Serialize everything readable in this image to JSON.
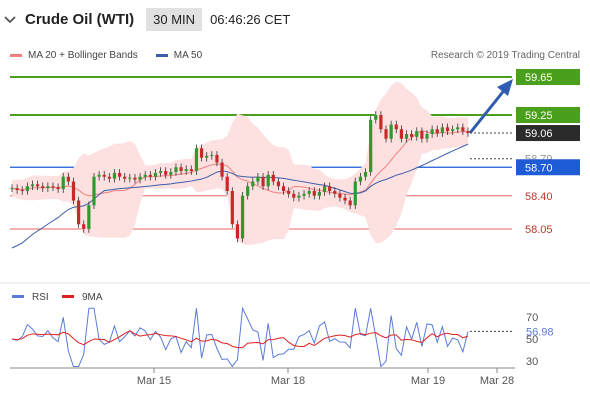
{
  "header": {
    "title": "Crude Oil (WTI)",
    "timeframe": "30 MIN",
    "time": "06:46:26 CET"
  },
  "legend": {
    "ma20_bb": "MA 20 + Bollinger Bands",
    "ma50": "MA 50",
    "copyright": "Research © 2019 Trading Central",
    "rsi": "RSI",
    "ma9": "9MA"
  },
  "colors": {
    "green": "#4aa01c",
    "red": "#f08080",
    "blue_line": "#1e5bd6",
    "ma50": "#3b5ea8",
    "bb_fill": "#fde0e0",
    "bullish": "#2e9a2e",
    "bearish": "#c82828",
    "last_price": "#2b2b2b",
    "rsi": "#5b7bd8",
    "rsi_ma": "#e02020",
    "arrow": "#2f5bb0"
  },
  "chart_data": {
    "type": "line",
    "price_axis": [
      59.65,
      59.25,
      59.06,
      58.79,
      58.7,
      58.4,
      58.05
    ],
    "resistance_levels": [
      59.65,
      59.25
    ],
    "support_levels": [
      58.4,
      58.05
    ],
    "pivot_level": 58.7,
    "last_price": 59.06,
    "ma50_value": 58.79,
    "x_ticks": [
      "Mar 15",
      "Mar 18",
      "Mar 19",
      "Mar 28"
    ],
    "price_close": [
      58.48,
      58.46,
      58.45,
      58.5,
      58.52,
      58.5,
      58.48,
      58.5,
      58.49,
      58.47,
      58.6,
      58.55,
      58.35,
      58.1,
      58.05,
      58.3,
      58.6,
      58.62,
      58.6,
      58.58,
      58.64,
      58.6,
      58.58,
      58.59,
      58.57,
      58.6,
      58.62,
      58.6,
      58.64,
      58.66,
      58.62,
      58.65,
      58.7,
      58.66,
      58.68,
      58.66,
      58.9,
      58.8,
      58.82,
      58.83,
      58.75,
      58.6,
      58.45,
      58.1,
      57.95,
      58.4,
      58.5,
      58.55,
      58.6,
      58.5,
      58.62,
      58.55,
      58.5,
      58.45,
      58.42,
      58.38,
      58.4,
      58.42,
      58.45,
      58.4,
      58.44,
      58.5,
      58.45,
      58.42,
      58.38,
      58.35,
      58.3,
      58.55,
      58.6,
      58.65,
      59.2,
      59.25,
      59.1,
      59.0,
      59.15,
      59.1,
      59.0,
      59.05,
      59.02,
      59.08,
      59.0,
      59.05,
      59.1,
      59.06,
      59.12,
      59.08,
      59.1,
      59.12,
      59.08,
      59.06
    ],
    "rsi_ticks": [
      70,
      56.98,
      50,
      30
    ],
    "rsi_value": 56.98,
    "rsi_ylim": [
      20,
      80
    ]
  }
}
